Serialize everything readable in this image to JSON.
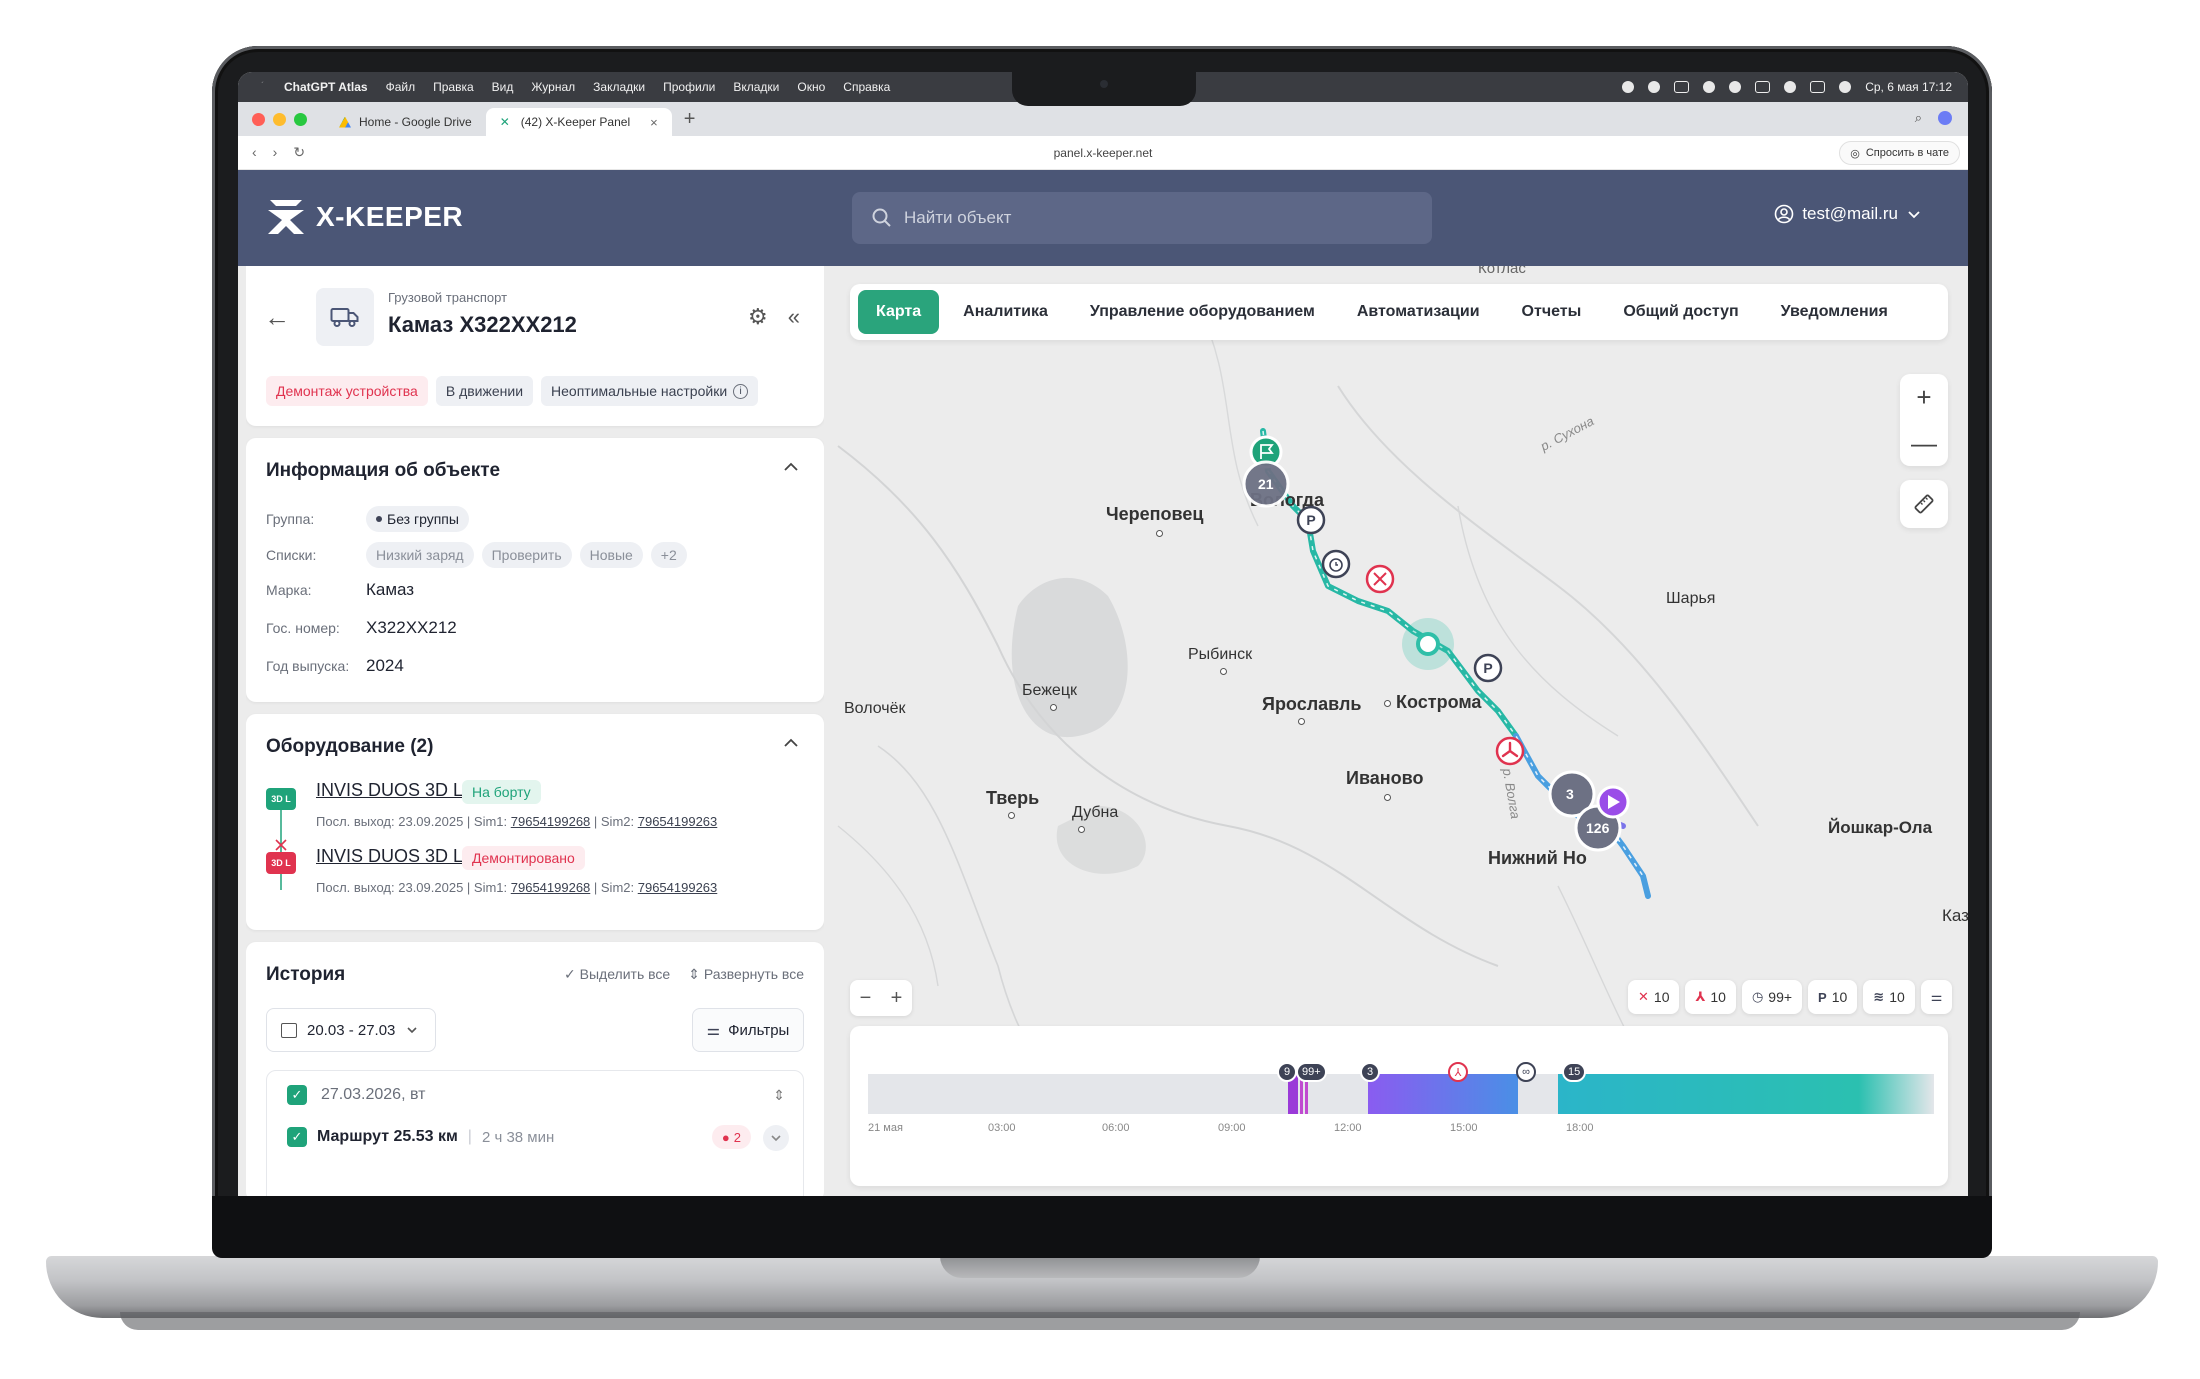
{
  "menubar": {
    "app": "ChatGPT Atlas",
    "items": [
      "Файл",
      "Правка",
      "Вид",
      "Журнал",
      "Закладки",
      "Профили",
      "Вкладки",
      "Окно",
      "Справка"
    ],
    "clock": "Ср, 6 мая  17:12"
  },
  "browser": {
    "tabs": [
      {
        "label": "Home - Google Drive",
        "active": false
      },
      {
        "label": "(42) X-Keeper Panel",
        "active": true
      }
    ],
    "url": "panel.x-keeper.net",
    "ask_label": "Спросить в чате"
  },
  "header": {
    "logo": "X-KEEPER",
    "search_placeholder": "Найти объект",
    "user": "test@mail.ru"
  },
  "map_tabs": [
    "Карта",
    "Аналитика",
    "Управление оборудованием",
    "Автоматизации",
    "Отчеты",
    "Общий доступ",
    "Уведомления"
  ],
  "vehicle": {
    "type": "Грузовой транспорт",
    "name": "Камаз Х322ХХ212",
    "chips": [
      "Демонтаж устройства",
      "В движении",
      "Неоптимальные настройки"
    ]
  },
  "info": {
    "title": "Информация об объекте",
    "rows": {
      "group_label": "Группа:",
      "group_value": "Без группы",
      "lists_label": "Списки:",
      "lists": [
        "Низкий заряд",
        "Проверить",
        "Новые",
        "+2"
      ],
      "brand_label": "Марка:",
      "brand_value": "Камаз",
      "plate_label": "Гос. номер:",
      "plate_value": "Х322ХХ212",
      "year_label": "Год выпуска:",
      "year_value": "2024"
    }
  },
  "equipment": {
    "title": "Оборудование (2)",
    "items": [
      {
        "icon": "3D L",
        "name": "INVIS DUOS 3D L",
        "status": "На борту",
        "meta_prefix": "Посл. выход: 23.09.2025 | Sim1: ",
        "sim1": "79654199268",
        "sim2_prefix": " | Sim2: ",
        "sim2": "79654199263"
      },
      {
        "icon": "3D L",
        "name": "INVIS DUOS 3D L",
        "status": "Демонтировано",
        "meta_prefix": "Посл. выход: 23.09.2025 | Sim1: ",
        "sim1": "79654199268",
        "sim2_prefix": " | Sim2: ",
        "sim2": "79654199263"
      }
    ]
  },
  "history": {
    "title": "История",
    "select_all": "Выделить все",
    "expand_all": "Развернуть все",
    "date_range": "20.03 - 27.03",
    "filters": "Фильтры",
    "day": "27.03.2026, вт",
    "route": "Маршрут 25.53 км",
    "route_duration": "2 ч 38 мин",
    "route_badge": "2"
  },
  "map_labels": {
    "kotlas": "Котлас",
    "sukhona": "р. Сухона",
    "vologda": "Вологда",
    "cherepovets": "Череповец",
    "sharya": "Шарья",
    "rybinsk": "Рыбинск",
    "bezhetsk": "Бежецк",
    "volochek": "Волочёк",
    "yaroslavl": "Ярославль",
    "kostroma": "Кострома",
    "ivanovo": "Иваново",
    "tver": "Тверь",
    "dubna": "Дубна",
    "volga": "р. Волга",
    "nizhny": "Нижний Но",
    "yoshkar": "Йошкар-Ола",
    "kaz": "Каз",
    "cluster_a": "21",
    "cluster_b": "3",
    "cluster_c": "126"
  },
  "counters": [
    {
      "icon": "no-signal-icon",
      "value": "10"
    },
    {
      "icon": "fan-icon",
      "value": "10"
    },
    {
      "icon": "alarm-icon",
      "value": "99+"
    },
    {
      "icon": "parking-icon",
      "value": "10"
    },
    {
      "icon": "wifi-icon",
      "value": "10"
    }
  ],
  "timeline": {
    "ticks": [
      "21 мая",
      "03:00",
      "06:00",
      "09:00",
      "12:00",
      "15:00",
      "18:00"
    ],
    "badges": [
      "9",
      "99+",
      "3",
      "15"
    ]
  },
  "colors": {
    "accent": "#2aa47c",
    "header": "#4b5676",
    "danger": "#e0334f",
    "route_teal": "#2bb5a9",
    "route_purple": "#8a5cf0"
  }
}
